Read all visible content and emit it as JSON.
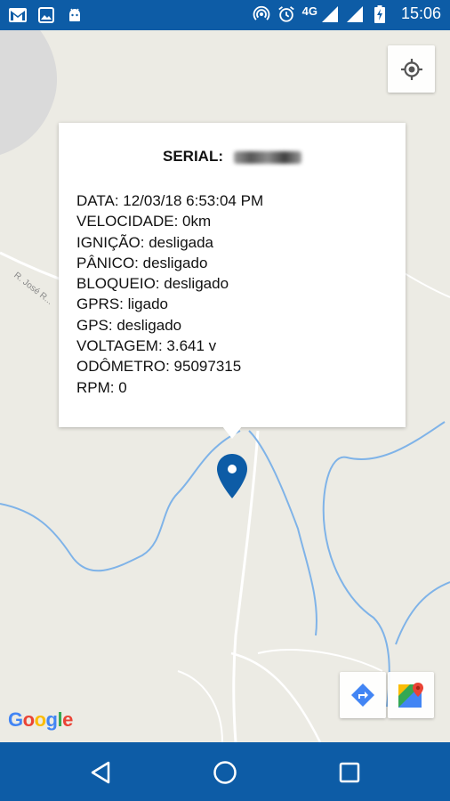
{
  "status_bar": {
    "network_type": "4G",
    "time": "15:06",
    "icons": [
      "gmail-icon",
      "gallery-icon",
      "android-icon",
      "hotspot-icon",
      "alarm-icon",
      "signal-icon",
      "signal-icon",
      "battery-charging-icon"
    ]
  },
  "map": {
    "street_label": "R. José R...",
    "provider_logo": [
      "G",
      "o",
      "o",
      "g",
      "l",
      "e"
    ],
    "logo_colors": [
      "#4285F4",
      "#EA4335",
      "#FBBC05",
      "#4285F4",
      "#34A853",
      "#EA4335"
    ],
    "marker_color": "#0d5ca6",
    "water_color": "#7fb3e8",
    "road_color": "#ffffff",
    "buttons": {
      "my_location": "my-location-icon",
      "directions": "directions-icon",
      "open_maps": "google-maps-icon"
    }
  },
  "info_window": {
    "serial_label": "SERIAL:",
    "lines": [
      "DATA: 12/03/18 6:53:04 PM",
      "VELOCIDADE: 0km",
      "IGNIÇÃO: desligada",
      "PÂNICO: desligado",
      "BLOQUEIO: desligado",
      "GPRS: ligado",
      "GPS: desligado",
      "VOLTAGEM: 3.641 v",
      "ODÔMETRO: 95097315",
      "RPM: 0"
    ]
  },
  "nav_bar": {
    "back": "back-icon",
    "home": "home-icon",
    "recents": "recents-icon"
  },
  "colors": {
    "brand": "#0d5ca6",
    "map_background": "#eceae3"
  }
}
